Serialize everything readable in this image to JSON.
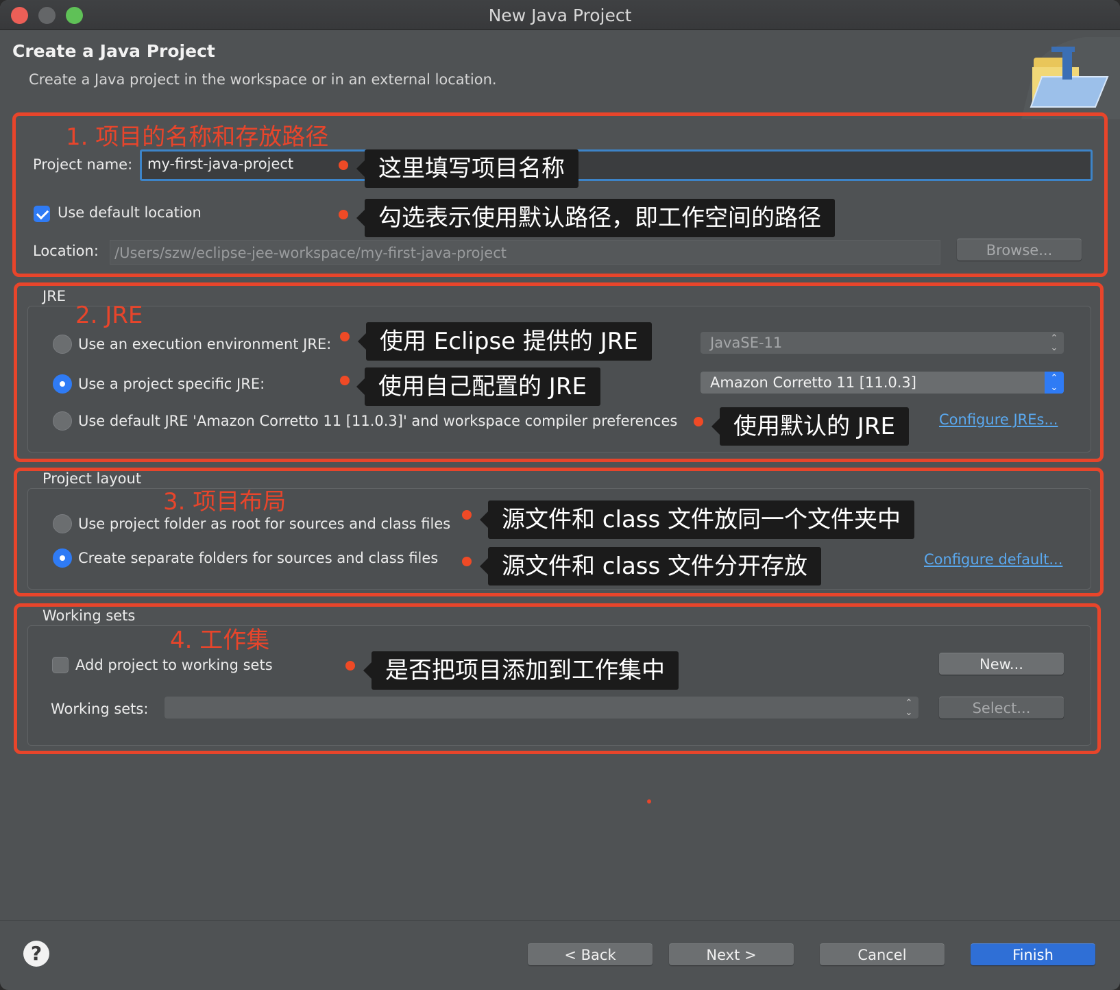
{
  "window": {
    "title": "New Java Project"
  },
  "header": {
    "title": "Create a Java Project",
    "description": "Create a Java project in the workspace or in an external location."
  },
  "section1": {
    "annotation": "1. 项目的名称和存放路径",
    "project_name_label": "Project name:",
    "project_name_value": "my-first-java-project",
    "project_name_tip": "这里填写项目名称",
    "use_default_location_label": "Use default location",
    "use_default_location_checked": true,
    "use_default_location_tip": "勾选表示使用默认路径，即工作空间的路径",
    "location_label": "Location:",
    "location_value": "/Users/szw/eclipse-jee-workspace/my-first-java-project",
    "browse_label": "Browse..."
  },
  "section2": {
    "group_title": "JRE",
    "annotation": "2. JRE",
    "option_env_label": "Use an execution environment JRE:",
    "option_env_tip": "使用 Eclipse 提供的 JRE",
    "option_env_select": "JavaSE-11",
    "option_specific_label": "Use a project specific JRE:",
    "option_specific_tip": "使用自己配置的 JRE",
    "option_specific_select": "Amazon Corretto 11 [11.0.3]",
    "option_default_label": "Use default JRE 'Amazon Corretto 11 [11.0.3]' and workspace compiler preferences",
    "option_default_tip": "使用默认的 JRE",
    "configure_jres_link": "Configure JREs...",
    "selected_option": "specific"
  },
  "section3": {
    "group_title": "Project layout",
    "annotation": "3. 项目布局",
    "option_root_label": "Use project folder as root for sources and class files",
    "option_root_tip": "源文件和 class 文件放同一个文件夹中",
    "option_separate_label": "Create separate folders for sources and class files",
    "option_separate_tip": "源文件和 class 文件分开存放",
    "configure_default_link": "Configure default...",
    "selected_option": "separate"
  },
  "section4": {
    "group_title": "Working sets",
    "annotation": "4. 工作集",
    "add_label": "Add project to working sets",
    "add_checked": false,
    "add_tip": "是否把项目添加到工作集中",
    "new_label": "New...",
    "working_sets_label": "Working sets:",
    "select_label": "Select..."
  },
  "footer": {
    "help_glyph": "?",
    "back_label": "< Back",
    "next_label": "Next >",
    "cancel_label": "Cancel",
    "finish_label": "Finish"
  },
  "colors": {
    "annotation_red": "#e8452b",
    "accent_blue": "#2f7bf5",
    "link_blue": "#5aa9f0",
    "window_bg": "#4f5254"
  }
}
